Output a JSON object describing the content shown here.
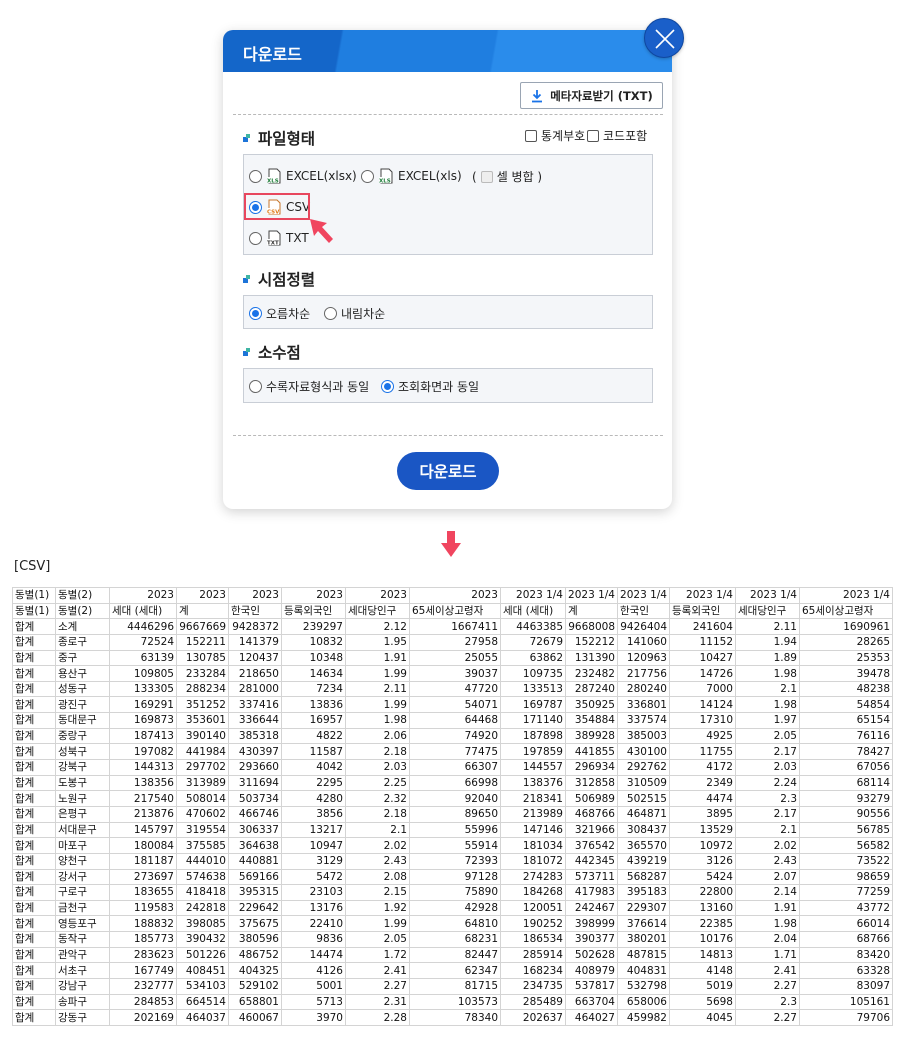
{
  "dialog": {
    "title": "다운로드",
    "meta_button_label": "메타자료받기 (TXT)",
    "file_format": {
      "title": "파일형태",
      "checkboxes": [
        {
          "label": "통계부호",
          "checked": false
        },
        {
          "label": "코드포함",
          "checked": false
        }
      ],
      "options": [
        {
          "label": "EXCEL(xlsx)",
          "icon": "xls-file-icon",
          "selected": false
        },
        {
          "label": "EXCEL(xls)",
          "icon": "xls-file-icon",
          "selected": false
        },
        {
          "label": "CSV",
          "icon": "csv-file-icon",
          "selected": true
        },
        {
          "label": "TXT",
          "icon": "txt-file-icon",
          "selected": false
        }
      ],
      "merge_open": "(",
      "merge_label": "셀 병합 )",
      "merge_checked": false
    },
    "time_sort": {
      "title": "시점정렬",
      "options": [
        {
          "label": "오름차순",
          "selected": true
        },
        {
          "label": "내림차순",
          "selected": false
        }
      ]
    },
    "decimal": {
      "title": "소수점",
      "options": [
        {
          "label": "수록자료형식과 동일",
          "selected": false
        },
        {
          "label": "조회화면과 동일",
          "selected": true
        }
      ]
    },
    "download_button_label": "다운로드"
  },
  "csv_label": "[CSV]",
  "colors": {
    "header_blue": "#1f7ee0",
    "button_blue": "#1a56c4",
    "highlight_red": "#e8475e",
    "arrow_pink": "#f0455f"
  },
  "table": {
    "header_rows": [
      [
        "동별(1)",
        "동별(2)",
        "2023",
        "2023",
        "2023",
        "2023",
        "2023",
        "2023",
        "2023 1/4",
        "2023 1/4",
        "2023 1/4",
        "2023 1/4",
        "2023 1/4",
        "2023 1/4"
      ],
      [
        "동별(1)",
        "동별(2)",
        "세대 (세대)",
        "계",
        "한국인",
        "등록외국인",
        "세대당인구",
        "65세이상고령자",
        "세대 (세대)",
        "계",
        "한국인",
        "등록외국인",
        "세대당인구",
        "65세이상고령자"
      ]
    ],
    "rows": [
      [
        "합계",
        "소계",
        "4446296",
        "9667669",
        "9428372",
        "239297",
        "2.12",
        "1667411",
        "4463385",
        "9668008",
        "9426404",
        "241604",
        "2.11",
        "1690961"
      ],
      [
        "합계",
        "종로구",
        "72524",
        "152211",
        "141379",
        "10832",
        "1.95",
        "27958",
        "72679",
        "152212",
        "141060",
        "11152",
        "1.94",
        "28265"
      ],
      [
        "합계",
        "중구",
        "63139",
        "130785",
        "120437",
        "10348",
        "1.91",
        "25055",
        "63862",
        "131390",
        "120963",
        "10427",
        "1.89",
        "25353"
      ],
      [
        "합계",
        "용산구",
        "109805",
        "233284",
        "218650",
        "14634",
        "1.99",
        "39037",
        "109735",
        "232482",
        "217756",
        "14726",
        "1.98",
        "39478"
      ],
      [
        "합계",
        "성동구",
        "133305",
        "288234",
        "281000",
        "7234",
        "2.11",
        "47720",
        "133513",
        "287240",
        "280240",
        "7000",
        "2.1",
        "48238"
      ],
      [
        "합계",
        "광진구",
        "169291",
        "351252",
        "337416",
        "13836",
        "1.99",
        "54071",
        "169787",
        "350925",
        "336801",
        "14124",
        "1.98",
        "54854"
      ],
      [
        "합계",
        "동대문구",
        "169873",
        "353601",
        "336644",
        "16957",
        "1.98",
        "64468",
        "171140",
        "354884",
        "337574",
        "17310",
        "1.97",
        "65154"
      ],
      [
        "합계",
        "중랑구",
        "187413",
        "390140",
        "385318",
        "4822",
        "2.06",
        "74920",
        "187898",
        "389928",
        "385003",
        "4925",
        "2.05",
        "76116"
      ],
      [
        "합계",
        "성북구",
        "197082",
        "441984",
        "430397",
        "11587",
        "2.18",
        "77475",
        "197859",
        "441855",
        "430100",
        "11755",
        "2.17",
        "78427"
      ],
      [
        "합계",
        "강북구",
        "144313",
        "297702",
        "293660",
        "4042",
        "2.03",
        "66307",
        "144557",
        "296934",
        "292762",
        "4172",
        "2.03",
        "67056"
      ],
      [
        "합계",
        "도봉구",
        "138356",
        "313989",
        "311694",
        "2295",
        "2.25",
        "66998",
        "138376",
        "312858",
        "310509",
        "2349",
        "2.24",
        "68114"
      ],
      [
        "합계",
        "노원구",
        "217540",
        "508014",
        "503734",
        "4280",
        "2.32",
        "92040",
        "218341",
        "506989",
        "502515",
        "4474",
        "2.3",
        "93279"
      ],
      [
        "합계",
        "은평구",
        "213876",
        "470602",
        "466746",
        "3856",
        "2.18",
        "89650",
        "213989",
        "468766",
        "464871",
        "3895",
        "2.17",
        "90556"
      ],
      [
        "합계",
        "서대문구",
        "145797",
        "319554",
        "306337",
        "13217",
        "2.1",
        "55996",
        "147146",
        "321966",
        "308437",
        "13529",
        "2.1",
        "56785"
      ],
      [
        "합계",
        "마포구",
        "180084",
        "375585",
        "364638",
        "10947",
        "2.02",
        "55914",
        "181034",
        "376542",
        "365570",
        "10972",
        "2.02",
        "56582"
      ],
      [
        "합계",
        "양천구",
        "181187",
        "444010",
        "440881",
        "3129",
        "2.43",
        "72393",
        "181072",
        "442345",
        "439219",
        "3126",
        "2.43",
        "73522"
      ],
      [
        "합계",
        "강서구",
        "273697",
        "574638",
        "569166",
        "5472",
        "2.08",
        "97128",
        "274283",
        "573711",
        "568287",
        "5424",
        "2.07",
        "98659"
      ],
      [
        "합계",
        "구로구",
        "183655",
        "418418",
        "395315",
        "23103",
        "2.15",
        "75890",
        "184268",
        "417983",
        "395183",
        "22800",
        "2.14",
        "77259"
      ],
      [
        "합계",
        "금천구",
        "119583",
        "242818",
        "229642",
        "13176",
        "1.92",
        "42928",
        "120051",
        "242467",
        "229307",
        "13160",
        "1.91",
        "43772"
      ],
      [
        "합계",
        "영등포구",
        "188832",
        "398085",
        "375675",
        "22410",
        "1.99",
        "64810",
        "190252",
        "398999",
        "376614",
        "22385",
        "1.98",
        "66014"
      ],
      [
        "합계",
        "동작구",
        "185773",
        "390432",
        "380596",
        "9836",
        "2.05",
        "68231",
        "186534",
        "390377",
        "380201",
        "10176",
        "2.04",
        "68766"
      ],
      [
        "합계",
        "관악구",
        "283623",
        "501226",
        "486752",
        "14474",
        "1.72",
        "82447",
        "285914",
        "502628",
        "487815",
        "14813",
        "1.71",
        "83420"
      ],
      [
        "합계",
        "서초구",
        "167749",
        "408451",
        "404325",
        "4126",
        "2.41",
        "62347",
        "168234",
        "408979",
        "404831",
        "4148",
        "2.41",
        "63328"
      ],
      [
        "합계",
        "강남구",
        "232777",
        "534103",
        "529102",
        "5001",
        "2.27",
        "81715",
        "234735",
        "537817",
        "532798",
        "5019",
        "2.27",
        "83097"
      ],
      [
        "합계",
        "송파구",
        "284853",
        "664514",
        "658801",
        "5713",
        "2.31",
        "103573",
        "285489",
        "663704",
        "658006",
        "5698",
        "2.3",
        "105161"
      ],
      [
        "합계",
        "강동구",
        "202169",
        "464037",
        "460067",
        "3970",
        "2.28",
        "78340",
        "202637",
        "464027",
        "459982",
        "4045",
        "2.27",
        "79706"
      ]
    ]
  }
}
